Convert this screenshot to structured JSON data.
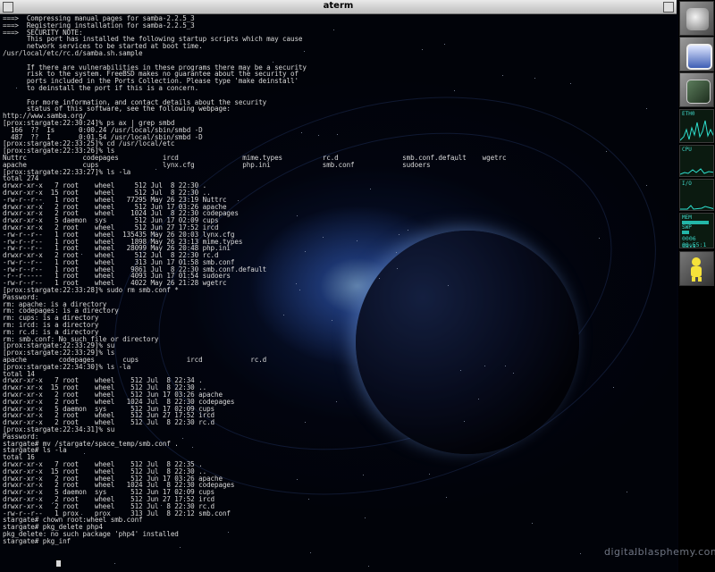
{
  "window": {
    "title": "aterm"
  },
  "terminal": {
    "lines": [
      "===>  Compressing manual pages for samba-2.2.5_3",
      "===>  Registering installation for samba-2.2.5_3",
      "===>  SECURITY NOTE:",
      "      This port has installed the following startup scripts which may cause",
      "      network services to be started at boot time.",
      "/usr/local/etc/rc.d/samba.sh.sample",
      "",
      "      If there are vulnerabilities in these programs there may be a security",
      "      risk to the system. FreeBSD makes no guarantee about the security of",
      "      ports included in the Ports Collection. Please type 'make deinstall'",
      "      to deinstall the port if this is a concern.",
      "",
      "      For more information, and contact details about the security",
      "      status of this software, see the following webpage:",
      "http://www.samba.org/",
      "[prox:stargate:22:30:24]% ps ax | grep smbd",
      "  166  ??  Is      0:00.24 /usr/local/sbin/smbd -D",
      "  487  ??  I       0:01.54 /usr/local/sbin/smbd -D",
      "[prox:stargate:22:33:25]% cd /usr/local/etc",
      "[prox:stargate:22:33:26]% ls",
      "Nuttrc              codepages           ircd                mime.types          rc.d                smb.conf.default    wgetrc",
      "apache              cups                lynx.cfg            php.ini             smb.conf            sudoers",
      "[prox:stargate:22:33:27]% ls -la",
      "total 274",
      "drwxr-xr-x   7 root    wheel     512 Jul  8 22:30 .",
      "drwxr-xr-x  15 root    wheel     512 Jul  8 22:30 ..",
      "-rw-r--r--   1 root    wheel   77295 May 26 23:19 Nuttrc",
      "drwxr-xr-x   2 root    wheel     512 Jun 17 03:26 apache",
      "drwxr-xr-x   2 root    wheel    1024 Jul  8 22:30 codepages",
      "drwxr-xr-x   5 daemon  sys       512 Jun 17 02:09 cups",
      "drwxr-xr-x   2 root    wheel     512 Jun 27 17:52 ircd",
      "-rw-r--r--   1 root    wheel  135435 May 26 20:03 lynx.cfg",
      "-rw-r--r--   1 root    wheel    1898 May 26 23:13 mime.types",
      "-rw-r--r--   1 root    wheel   28099 May 26 20:48 php.ini",
      "drwxr-xr-x   2 root    wheel     512 Jul  8 22:30 rc.d",
      "-rw-r--r--   1 root    wheel     313 Jun 17 01:58 smb.conf",
      "-rw-r--r--   1 root    wheel    9861 Jul  8 22:30 smb.conf.default",
      "-r--r-----   1 root    wheel    4093 Jun 17 01:54 sudoers",
      "-rw-r--r--   1 root    wheel    4022 May 26 21:28 wgetrc",
      "[prox:stargate:22:33:28]% sudo rm smb.conf *",
      "Password:",
      "rm: apache: is a directory",
      "rm: codepages: is a directory",
      "rm: cups: is a directory",
      "rm: ircd: is a directory",
      "rm: rc.d: is a directory",
      "rm: smb.conf: No such file or directory",
      "[prox:stargate:22:33:29]% su",
      "[prox:stargate:22:33:29]% ls",
      "apache        codepages       cups            ircd            rc.d",
      "[prox:stargate:22:34:30]% ls -la",
      "total 14",
      "drwxr-xr-x   7 root    wheel    512 Jul  8 22:34 .",
      "drwxr-xr-x  15 root    wheel    512 Jul  8 22:30 ..",
      "drwxr-xr-x   2 root    wheel    512 Jun 17 03:26 apache",
      "drwxr-xr-x   2 root    wheel   1024 Jul  8 22:30 codepages",
      "drwxr-xr-x   5 daemon  sys      512 Jun 17 02:09 cups",
      "drwxr-xr-x   2 root    wheel    512 Jun 27 17:52 ircd",
      "drwxr-xr-x   2 root    wheel    512 Jul  8 22:30 rc.d",
      "[prox:stargate:22:34:31]% su",
      "Password:",
      "stargate# mv /stargate/space_temp/smb.conf .",
      "stargate# ls -la",
      "total 16",
      "drwxr-xr-x   7 root    wheel    512 Jul  8 22:35 .",
      "drwxr-xr-x  15 root    wheel    512 Jul  8 22:30 ..",
      "drwxr-xr-x   2 root    wheel    512 Jun 17 03:26 apache",
      "drwxr-xr-x   2 root    wheel   1024 Jul  8 22:30 codepages",
      "drwxr-xr-x   5 daemon  sys      512 Jun 17 02:09 cups",
      "drwxr-xr-x   2 root    wheel    512 Jun 27 17:52 ircd",
      "drwxr-xr-x   2 root    wheel    512 Jul  8 22:30 rc.d",
      "-rw-r--r--   1 prox    prox     313 Jul  8 22:12 smb.conf",
      "stargate# chown root:wheel smb.conf",
      "stargate# pkg_delete php4",
      "pkg_delete: no such package 'php4' installed",
      "stargate# pkg_inf"
    ]
  },
  "dock": {
    "tiles": [
      {
        "icon": "system-prefs-icon"
      },
      {
        "icon": "monitor-icon"
      },
      {
        "icon": "terminal-icon"
      }
    ],
    "monitors": {
      "eth0_label": "ETH0",
      "cpu_label": "CPU",
      "io_label": "I/O",
      "mem_label": "MEM",
      "swp_label": "SWP",
      "uptime_days": "0006 days",
      "uptime_time": "00:55:1"
    }
  },
  "watermark": "digitalblasphemy.com",
  "colors": {
    "terminal_text": "#d8d8d8",
    "monitor_accent": "#23b7a8",
    "titlebar": "#d4d4d4"
  }
}
